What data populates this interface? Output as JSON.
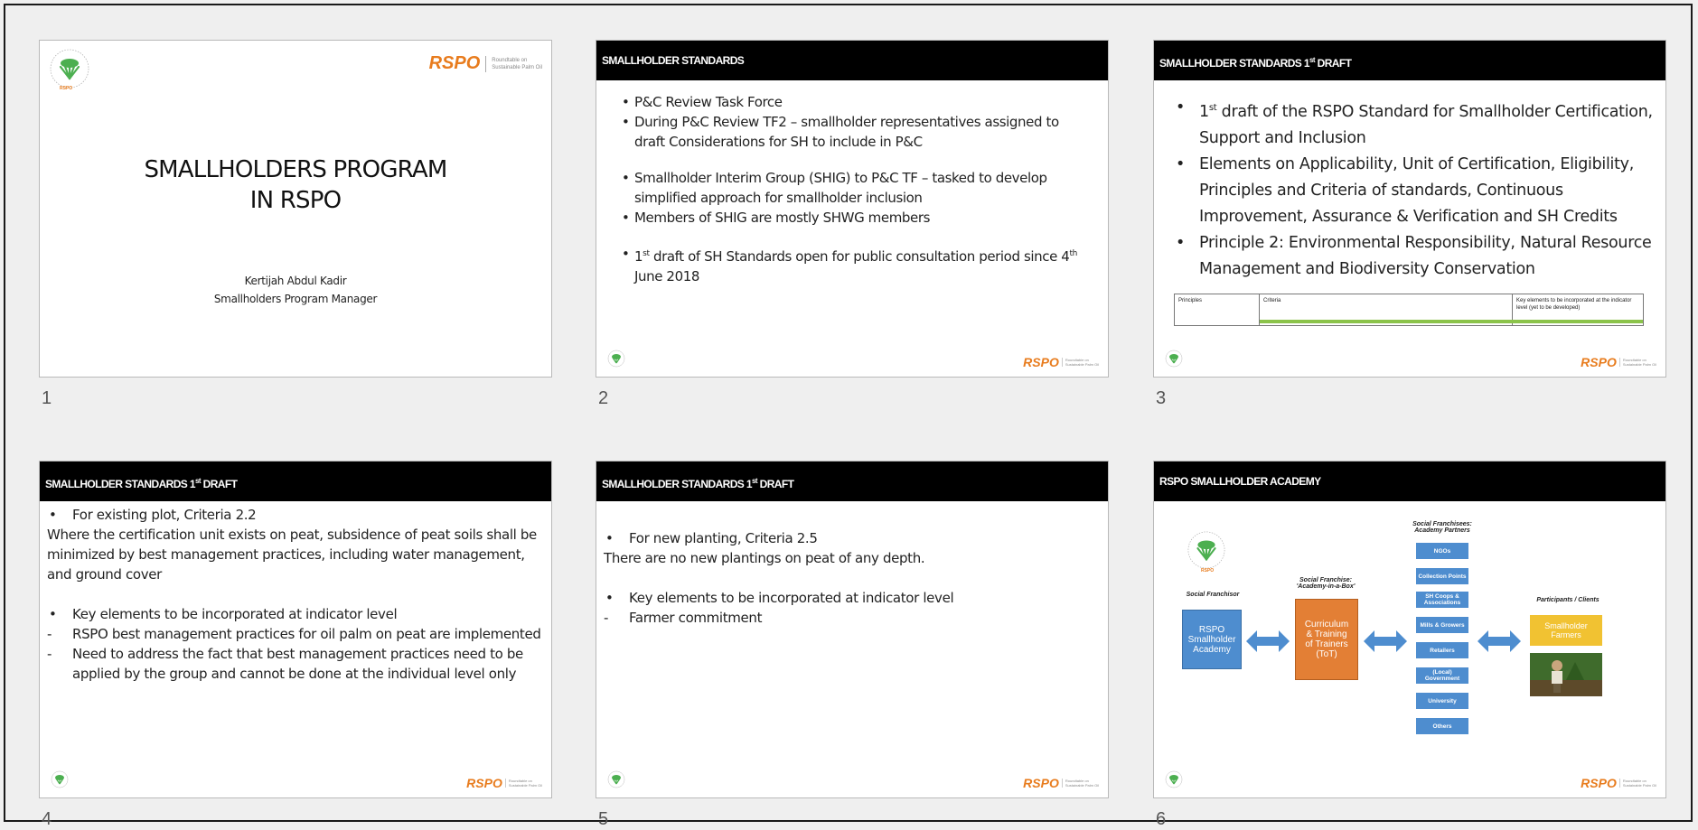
{
  "colors": {
    "header": "#000000",
    "accent": "#e87c1e",
    "blue": "#4e8dcf",
    "orange": "#e37f35",
    "yellow": "#f1c232"
  },
  "slides": [
    {
      "number": "1",
      "title_line1": "SMALLHOLDERS PROGRAM",
      "title_line2": "IN RSPO",
      "presenter": "Kertijah Abdul Kadir",
      "role": "Smallholders Program Manager",
      "logo_word": "RSPO",
      "logo_tag1": "Roundtable on",
      "logo_tag2": "Sustainable Palm Oil",
      "seal_text": "RSPO"
    },
    {
      "number": "2",
      "header": "SMALLHOLDER STANDARDS",
      "bullets": [
        "P&C Review Task Force",
        "During P&C Review TF2 – smallholder representatives assigned to draft Considerations for SH to include in P&C",
        "Smallholder Interim Group (SHIG) to P&C TF – tasked to develop simplified approach for smallholder inclusion",
        "Members of SHIG are mostly SHWG members"
      ],
      "b5_pre": "1",
      "b5_sup": "st",
      "b5_post": " draft of SH Standards open for public consultation period since 4",
      "b5_sup2": "th",
      "b5_end": " June 2018"
    },
    {
      "number": "3",
      "header_pre": "SMALLHOLDER STANDARDS 1",
      "header_sup": "st",
      "header_post": " DRAFT",
      "b1_pre": "1",
      "b1_sup": "st",
      "b1_post": " draft of the RSPO Standard for Smallholder Certification, Support and Inclusion",
      "b2": "Elements on Applicability, Unit of Certification, Eligibility, Principles and Criteria of standards, Continuous Improvement, Assurance & Verification and SH Credits",
      "b3": "Principle 2: Environmental Responsibility, Natural Resource Management and Biodiversity Conservation",
      "table_headers": [
        "Principles",
        "Criteria",
        "Key elements to be incorporated at the indicator level (yet to be developed)"
      ]
    },
    {
      "number": "4",
      "header_pre": "SMALLHOLDER STANDARDS 1",
      "header_sup": "st",
      "header_post": " DRAFT",
      "b1": "For existing plot, Criteria 2.2",
      "para": "Where the certification unit exists on peat, subsidence of peat soils shall be minimized by best management practices, including water management, and ground cover",
      "b2": "Key elements to be incorporated at indicator level",
      "d1": "RSPO best management practices for oil palm on peat are implemented",
      "d2": "Need to address the fact that best management practices need to be applied by the group and cannot be done at the individual level only"
    },
    {
      "number": "5",
      "header_pre": "SMALLHOLDER STANDARDS 1",
      "header_sup": "st",
      "header_post": " DRAFT",
      "b1": "For new planting, Criteria 2.5",
      "para": "There are no new plantings on peat of any depth.",
      "b2": "Key elements to be incorporated at indicator level",
      "d1": "Farmer commitment"
    },
    {
      "number": "6",
      "header": "RSPO SMALLHOLDER ACADEMY",
      "franchisor_label": "Social Franchisor",
      "franchisor_box": "RSPO Smallholder Academy",
      "franchise_label": "Social Franchise: 'Academy-in-a-Box'",
      "curriculum_box": "Curriculum & Training of Trainers (ToT)",
      "partners_label": "Social Franchisees: Academy Partners",
      "partners": [
        "NGOs",
        "Collection Points",
        "SH Coops & Associations",
        "Mills & Growers",
        "Retailers",
        "(Local) Government",
        "University",
        "Others"
      ],
      "clients_label": "Participants / Clients",
      "clients_box": "Smallholder Farmers",
      "seal_text": "RSPO"
    }
  ]
}
